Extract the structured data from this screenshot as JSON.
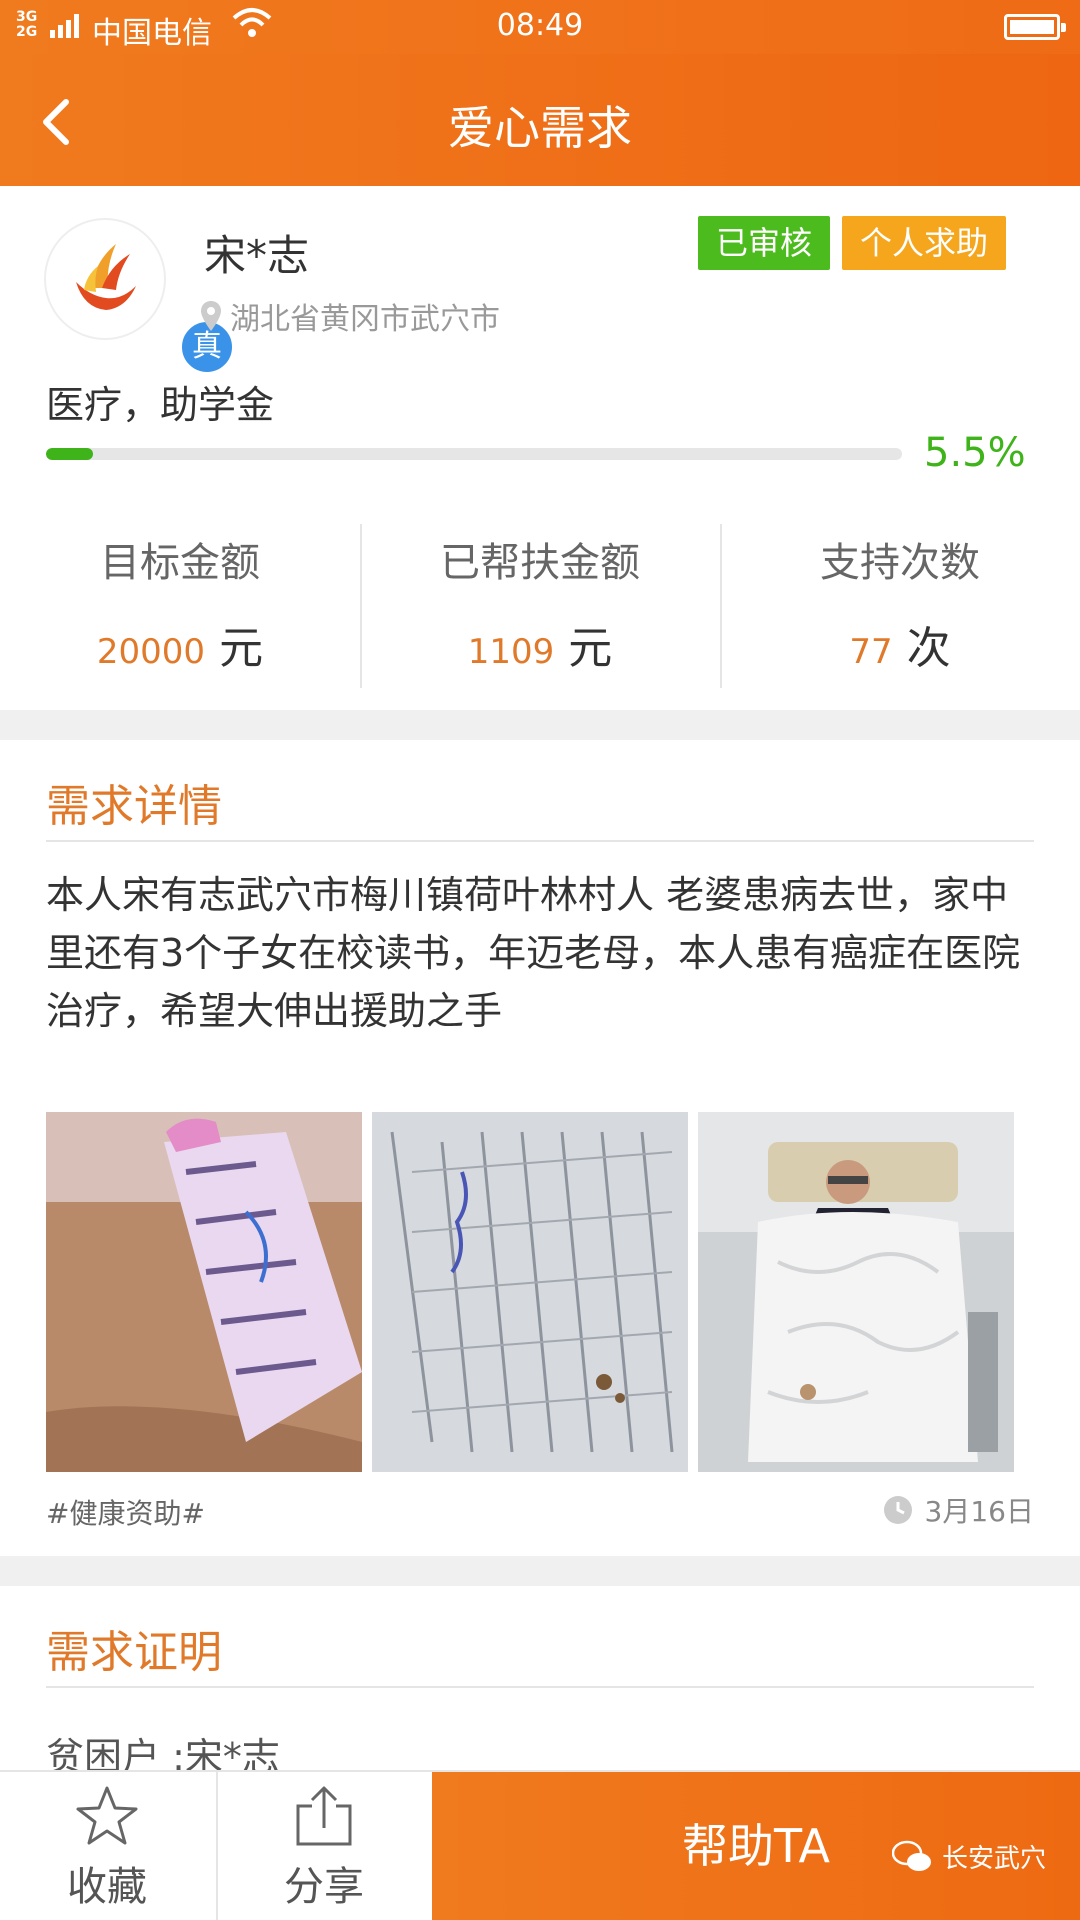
{
  "status_bar": {
    "network": "3G 2G",
    "carrier": "中国电信",
    "time": "08:49"
  },
  "nav": {
    "back_icon": "chevron-left-icon",
    "title": "爱心需求"
  },
  "profile": {
    "name": "宋*志",
    "verified_badge": "真",
    "location": "湖北省黄冈市武穴市",
    "tags": [
      "已审核",
      "个人求助"
    ],
    "purpose": "医疗，助学金",
    "progress_fraction": 0.055,
    "progress_label": "5.5%"
  },
  "stats": [
    {
      "label": "目标金额",
      "value": "20000",
      "unit": "元"
    },
    {
      "label": "已帮扶金额",
      "value": "1109",
      "unit": "元"
    },
    {
      "label": "支持次数",
      "value": "77",
      "unit": "次"
    }
  ],
  "detail": {
    "title": "需求详情",
    "text": "本人宋有志武穴市梅川镇荷叶林村人 老婆患病去世，家中里还有3个子女在校读书，年迈老母，本人患有癌症在医院治疗，希望大伸出援助之手",
    "hashtag": "#健康资助#",
    "date": "3月16日"
  },
  "proof": {
    "title": "需求证明",
    "text": "贫困户 :宋*志"
  },
  "bottom_bar": {
    "favorite_label": "收藏",
    "share_label": "分享",
    "help_label": "帮助TA"
  },
  "watermark": "长安武穴",
  "colors": {
    "brand_orange": "#ef6b16",
    "accent_orange_text": "#e07a2a",
    "progress_green": "#3fb31a",
    "tag_green": "#4cbb1d",
    "tag_yellow": "#f5a61d",
    "verified_blue": "#3a93e8"
  }
}
